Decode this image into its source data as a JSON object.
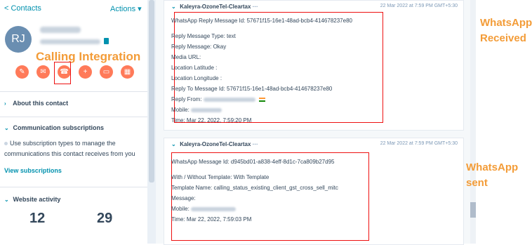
{
  "sidebar": {
    "back_link": "< Contacts",
    "actions": "Actions ▾",
    "avatar": "RJ",
    "calling_label": "Calling Integration",
    "sections": {
      "about": "About this contact",
      "comms": "Communication subscriptions",
      "website": "Website activity"
    },
    "subscription_text": "Use subscription types to manage the communications this contact receives from you",
    "view_subscriptions": "View subscriptions",
    "stats": [
      "12",
      "29"
    ],
    "action_icons": [
      "note-icon",
      "email-icon",
      "call-icon",
      "add-icon",
      "task-icon",
      "meeting-icon"
    ]
  },
  "cards": [
    {
      "header": "Kaleyra-OzoneTel-Cleartax",
      "date": "22 Mar 2022 at 7:59 PM GMT+5:30",
      "id_line": "WhatsApp Reply Message Id: 57671f15-16e1-48ad-bcb4-414678237e80",
      "lines": [
        "Reply Message Type: text",
        "Reply Message: Okay",
        "Media URL:",
        "Location Latitude :",
        "Location Longitude :",
        "Reply To Message Id: 57671f15-16e1-48ad-bcb4-414678237e80",
        "Reply From:",
        "Mobile:",
        "Time: Mar 22, 2022, 7:59:20 PM"
      ],
      "annotation": [
        "WhatsApp",
        "Received"
      ]
    },
    {
      "header": "Kaleyra-OzoneTel-Cleartax",
      "date": "22 Mar 2022 at 7:59 PM GMT+5:30",
      "id_line": "WhatsApp Message Id: d945bd01-a838-4eff-8d1c-7ca809b27d95",
      "lines": [
        "With / Without Template: With Template",
        "Template Name: calling_status_existing_client_gst_cross_sell_mitc",
        "Message:",
        "Mobile:",
        "Time: Mar 22, 2022, 7:59:03 PM"
      ],
      "annotation": [
        "WhatsApp",
        "sent"
      ]
    }
  ],
  "colors": {
    "accent_orange": "#ff7a59",
    "annotation_orange": "#f39c38",
    "link_teal": "#0091ae",
    "highlight_red": "#ee1111"
  }
}
